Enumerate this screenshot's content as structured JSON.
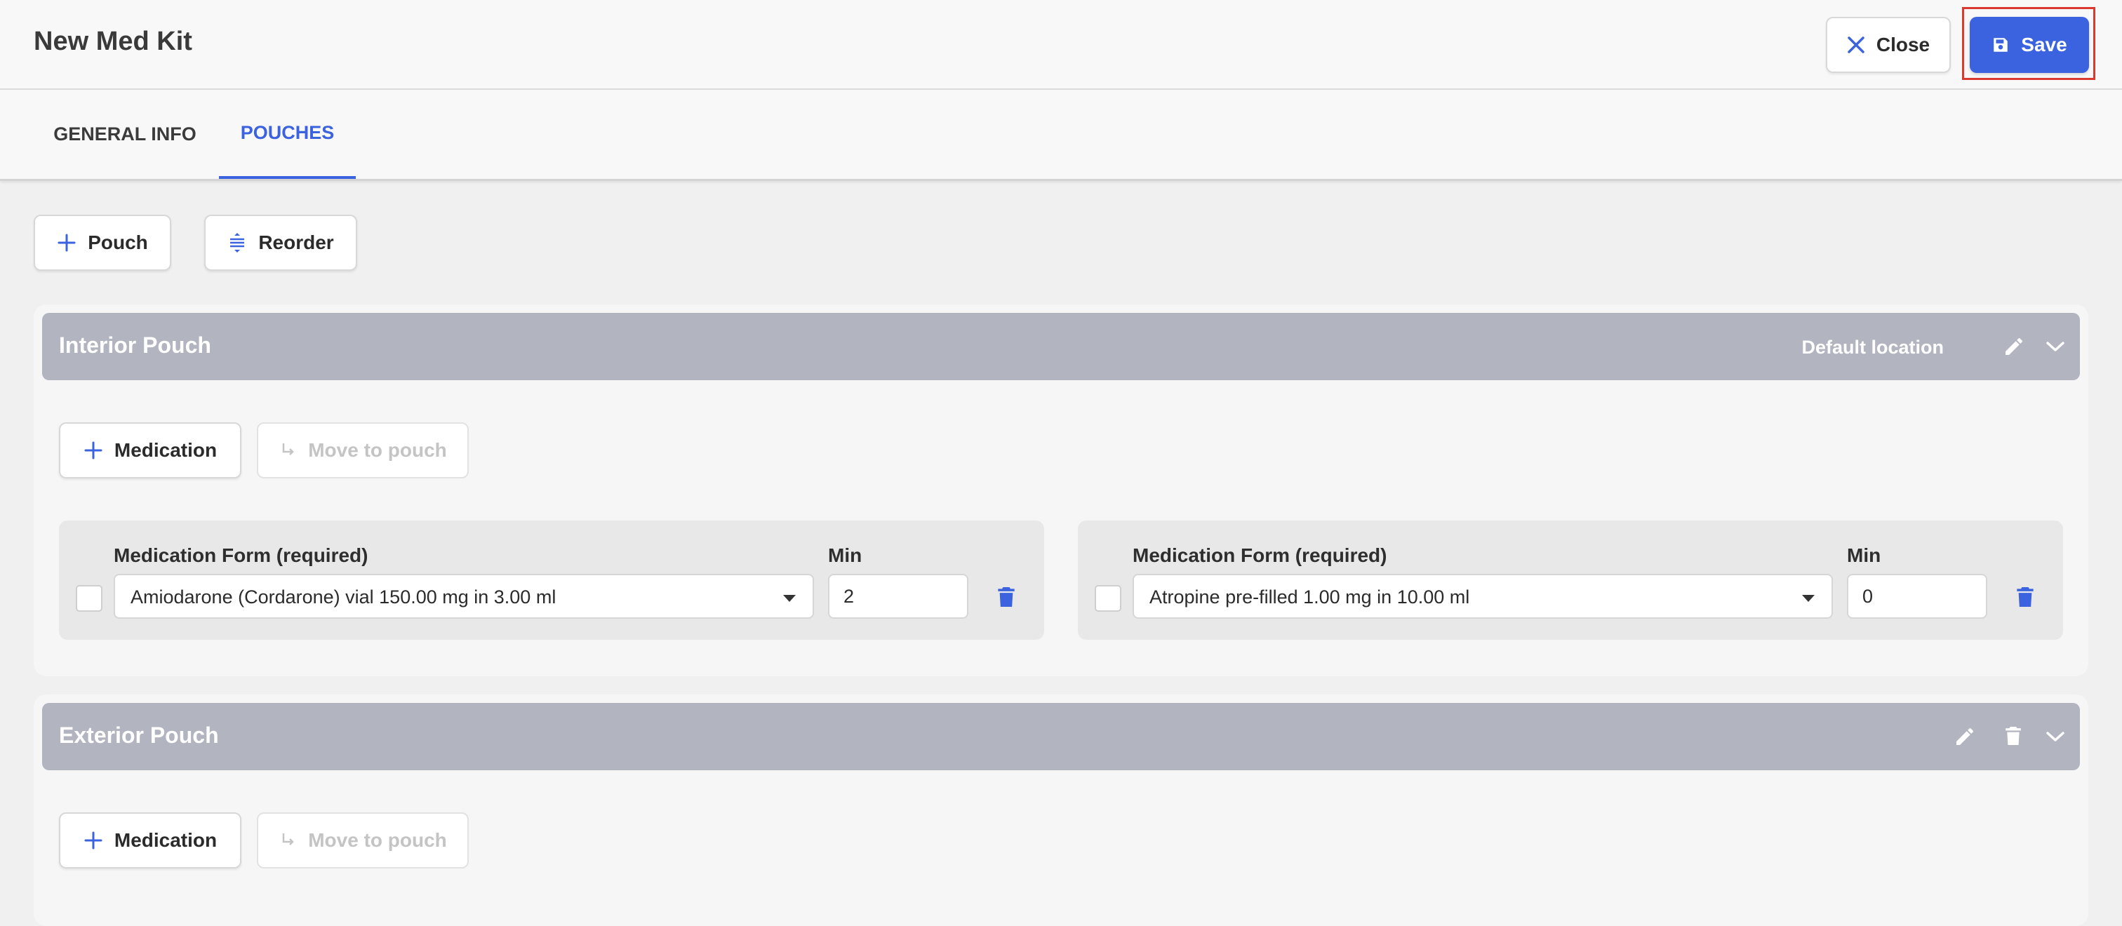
{
  "header": {
    "title": "New Med Kit",
    "close_label": "Close",
    "save_label": "Save"
  },
  "tabs": [
    {
      "label": "GENERAL INFO",
      "active": false
    },
    {
      "label": "POUCHES",
      "active": true
    }
  ],
  "toolbar": {
    "add_pouch_label": "Pouch",
    "reorder_label": "Reorder"
  },
  "pouches": [
    {
      "name": "Interior Pouch",
      "location": "Default location",
      "add_medication_label": "Medication",
      "move_to_pouch_label": "Move to pouch",
      "medications": [
        {
          "form_label": "Medication Form (required)",
          "form_value": "Amiodarone (Cordarone) vial 150.00 mg in 3.00 ml",
          "min_label": "Min",
          "min_value": "2"
        },
        {
          "form_label": "Medication Form (required)",
          "form_value": "Atropine pre-filled 1.00 mg in 10.00 ml",
          "min_label": "Min",
          "min_value": "0"
        }
      ]
    },
    {
      "name": "Exterior Pouch",
      "location": "",
      "add_medication_label": "Medication",
      "move_to_pouch_label": "Move to pouch",
      "medications": []
    }
  ],
  "colors": {
    "accent": "#3b63e0",
    "pouch_header": "#b2b5bf",
    "highlight": "#d9392f"
  }
}
